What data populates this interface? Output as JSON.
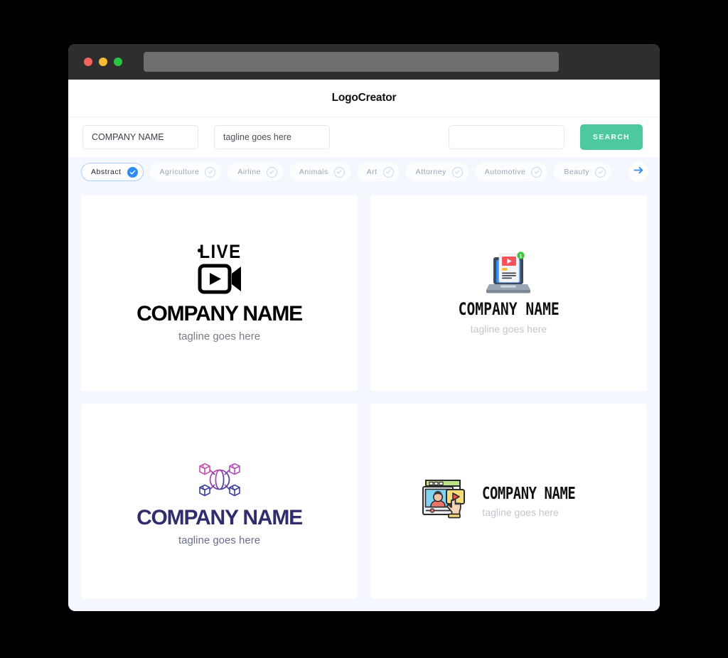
{
  "window": {
    "traffic_lights": [
      "close-red",
      "minimize-yellow",
      "maximize-green"
    ],
    "address_bar_value": ""
  },
  "header": {
    "app_title": "LogoCreator"
  },
  "search": {
    "company_name_value": "COMPANY NAME",
    "company_name_placeholder": "COMPANY NAME",
    "tagline_value": "tagline goes here",
    "tagline_placeholder": "tagline goes here",
    "keyword_value": "",
    "keyword_placeholder": "",
    "search_button_label": "SEARCH"
  },
  "categories": {
    "next_arrow_icon": "arrow-right-icon",
    "items": [
      {
        "label": "Abstract",
        "selected": true,
        "icon": "check-circle-filled-icon"
      },
      {
        "label": "Agriculture",
        "selected": false,
        "icon": "check-circle-outline-icon"
      },
      {
        "label": "Airline",
        "selected": false,
        "icon": "check-circle-outline-icon"
      },
      {
        "label": "Animals",
        "selected": false,
        "icon": "check-circle-outline-icon"
      },
      {
        "label": "Art",
        "selected": false,
        "icon": "check-circle-outline-icon"
      },
      {
        "label": "Attorney",
        "selected": false,
        "icon": "check-circle-outline-icon"
      },
      {
        "label": "Automotive",
        "selected": false,
        "icon": "check-circle-outline-icon"
      },
      {
        "label": "Beauty",
        "selected": false,
        "icon": "check-circle-outline-icon"
      }
    ]
  },
  "results": {
    "cards": [
      {
        "mark_icon": "live-video-camera-icon",
        "mark_word": "LIVE",
        "company_name": "COMPANY NAME",
        "tagline": "tagline goes here",
        "layout": "stacked"
      },
      {
        "mark_icon": "laptop-video-article-icon",
        "badge_count": "1",
        "company_name": "COMPANY NAME",
        "tagline": "tagline goes here",
        "layout": "stacked"
      },
      {
        "mark_icon": "globe-boxes-network-icon",
        "company_name": "COMPANY NAME",
        "tagline": "tagline goes here",
        "layout": "stacked"
      },
      {
        "mark_icon": "video-player-click-icon",
        "company_name": "COMPANY NAME",
        "tagline": "tagline goes here",
        "layout": "horizontal"
      }
    ]
  },
  "colors": {
    "page_background": "#f4f7fd",
    "titlebar": "#2e2e2e",
    "accent_green": "#4dc9a0",
    "accent_blue": "#2f8bf5",
    "card": "#ffffff",
    "navy_text": "#312c6b"
  }
}
